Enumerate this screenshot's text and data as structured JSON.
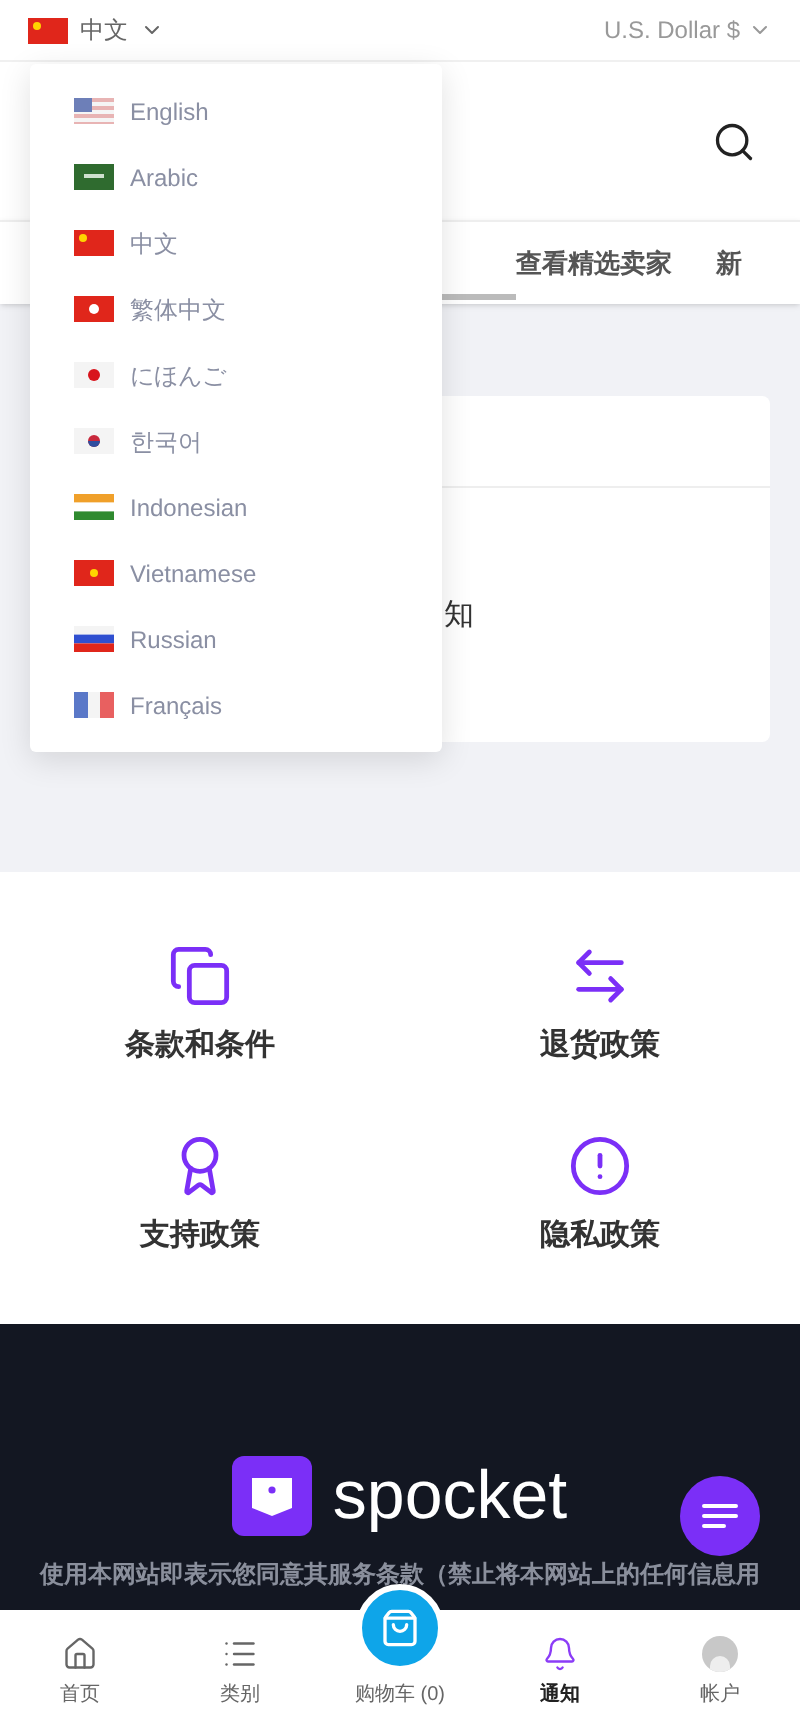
{
  "top_bar": {
    "language": "中文",
    "currency": "U.S. Dollar $"
  },
  "language_menu": [
    {
      "label": "English",
      "kind": "us"
    },
    {
      "label": "Arabic",
      "kind": "sa"
    },
    {
      "label": "中文",
      "kind": "cn"
    },
    {
      "label": "繁体中文",
      "kind": "hk"
    },
    {
      "label": "にほんご",
      "kind": "jp"
    },
    {
      "label": "한국어",
      "kind": "kr"
    },
    {
      "label": "Indonesian",
      "kind": "in"
    },
    {
      "label": "Vietnamese",
      "kind": "vn"
    },
    {
      "label": "Russian",
      "kind": "ru"
    },
    {
      "label": "Français",
      "kind": "fr"
    }
  ],
  "tabs": [
    {
      "label": "查看精选卖家",
      "selected": false
    },
    {
      "label": "新",
      "selected": false
    }
  ],
  "card": {
    "text": "知"
  },
  "policy_links": [
    {
      "label": "条款和条件",
      "kind": "copy"
    },
    {
      "label": "退货政策",
      "kind": "swap"
    },
    {
      "label": "支持政策",
      "kind": "award"
    },
    {
      "label": "隐私政策",
      "kind": "alert"
    }
  ],
  "footer": {
    "brand": "spocket",
    "notice": "使用本网站即表示您同意其服务条款（禁止将本网站上的任何信息用"
  },
  "bottom_nav": [
    {
      "label": "首页",
      "kind": "home",
      "selected": false
    },
    {
      "label": "类别",
      "kind": "list",
      "selected": false
    },
    {
      "label": "购物车 (0)",
      "kind": "cart",
      "selected": false
    },
    {
      "label": "通知",
      "kind": "bell",
      "selected": true
    },
    {
      "label": "帐户",
      "kind": "avatar",
      "selected": false
    }
  ]
}
